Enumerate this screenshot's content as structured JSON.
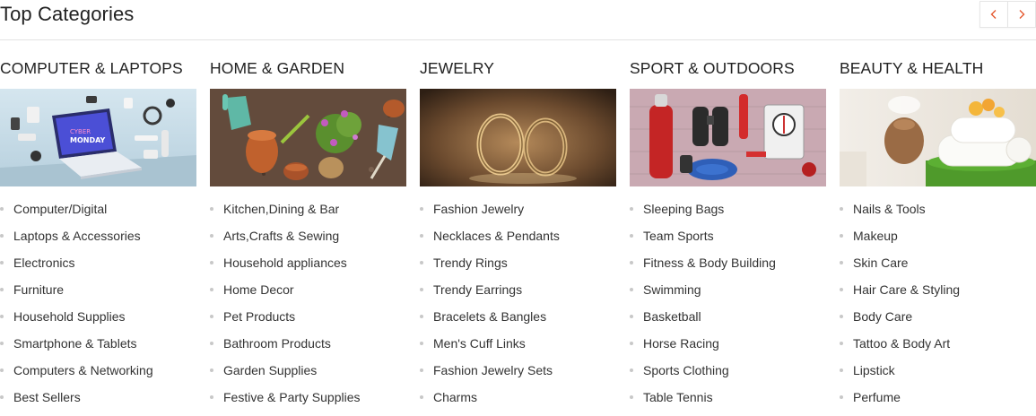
{
  "header": {
    "title": "Top Categories",
    "prev_icon": "chevron-left-icon",
    "next_icon": "chevron-right-icon",
    "accent_color": "#e4572e"
  },
  "categories": [
    {
      "title": "COMPUTER & LAPTOPS",
      "image": "laptop-devices-image",
      "laptop_screen_text": [
        "CYBER",
        "MONDAY"
      ],
      "items": [
        "Computer/Digital",
        "Laptops & Accessories",
        "Electronics",
        "Furniture",
        "Household Supplies",
        "Smartphone & Tablets",
        "Computers & Networking",
        "Best Sellers"
      ]
    },
    {
      "title": "HOME & GARDEN",
      "image": "garden-tools-image",
      "items": [
        "Kitchen,Dining & Bar",
        "Arts,Crafts & Sewing",
        "Household appliances",
        "Home Decor",
        "Pet Products",
        "Bathroom Products",
        "Garden Supplies",
        "Festive & Party Supplies"
      ]
    },
    {
      "title": "JEWELRY",
      "image": "rings-image",
      "items": [
        "Fashion Jewelry",
        "Necklaces & Pendants",
        "Trendy Rings",
        "Trendy Earrings",
        "Bracelets & Bangles",
        "Men's Cuff Links",
        "Fashion Jewelry Sets",
        "Charms"
      ]
    },
    {
      "title": "SPORT & OUTDOORS",
      "image": "outdoor-gear-image",
      "items": [
        "Sleeping Bags",
        "Team Sports",
        "Fitness & Body Building",
        "Swimming",
        "Basketball",
        "Horse Racing",
        "Sports Clothing",
        "Table Tennis"
      ]
    },
    {
      "title": "BEAUTY & HEALTH",
      "image": "spa-towels-image",
      "items": [
        "Nails & Tools",
        "Makeup",
        "Skin Care",
        "Hair Care & Styling",
        "Body Care",
        "Tattoo & Body Art",
        "Lipstick",
        "Perfume"
      ]
    }
  ]
}
